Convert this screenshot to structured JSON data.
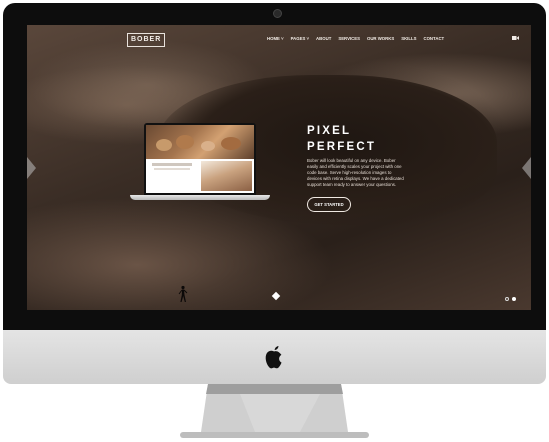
{
  "brand": {
    "logo": "BOBER"
  },
  "nav": {
    "items": [
      "HOME ˅",
      "PAGES ˅",
      "ABOUT",
      "SERVICES",
      "OUR WORKS",
      "SKILLS",
      "CONTACT"
    ]
  },
  "hero": {
    "title_line1": "PIXEL",
    "title_line2": "PERFECT",
    "description": "Bober will look beautiful on any device. Bober easily and efficiently scales your project with one code base. Serve high-resolution images to devices with retina displays. We have a dedicated support team ready to answer your questions.",
    "cta": "GET STARTED"
  },
  "icons": {
    "nav_toggle": "video-camera-icon",
    "prev": "chevron-left-icon",
    "next": "chevron-right-icon",
    "scroll": "diamond-icon",
    "brand": "apple-logo-icon"
  },
  "colors": {
    "bezel": "#0d0d0d",
    "chin": "#d9d9d9",
    "text": "#ffffff"
  }
}
